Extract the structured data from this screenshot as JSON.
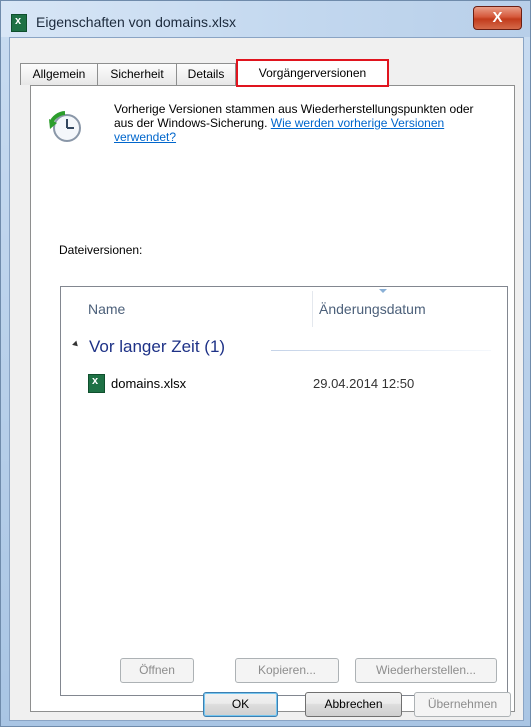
{
  "window": {
    "title": "Eigenschaften von domains.xlsx",
    "close_label": "X"
  },
  "tabs": [
    {
      "label": "Allgemein",
      "active": false
    },
    {
      "label": "Sicherheit",
      "active": false
    },
    {
      "label": "Details",
      "active": false
    },
    {
      "label": "Vorgängerversionen",
      "active": true
    }
  ],
  "info": {
    "text": "Vorherige Versionen stammen aus Wiederherstellungspunkten oder aus der Windows-Sicherung.",
    "link": "Wie werden vorherige Versionen verwendet?",
    "icon": "restore-clock-icon"
  },
  "versions_label": "Dateiversionen:",
  "list": {
    "columns": [
      "Name",
      "Änderungsdatum"
    ],
    "group": "Vor langer Zeit (1)",
    "items": [
      {
        "name": "domains.xlsx",
        "date": "29.04.2014 12:50",
        "icon": "excel-file-icon"
      }
    ]
  },
  "actions": {
    "open": "Öffnen",
    "copy": "Kopieren...",
    "restore": "Wiederherstellen..."
  },
  "dialog_buttons": {
    "ok": "OK",
    "cancel": "Abbrechen",
    "apply": "Übernehmen"
  },
  "colors": {
    "active_tab_highlight": "#e0141e",
    "link": "#0066cc",
    "group_title": "#1e3287"
  }
}
